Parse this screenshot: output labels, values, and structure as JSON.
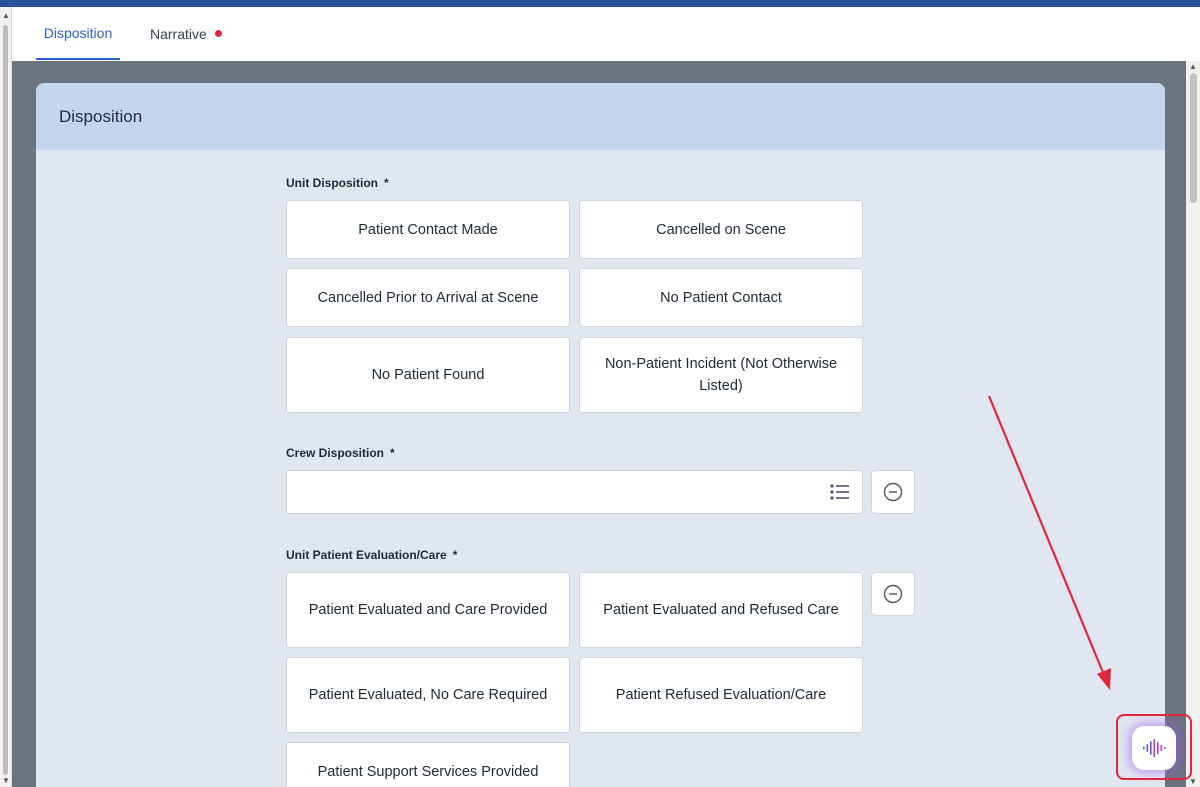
{
  "tabs": [
    {
      "label": "Disposition",
      "active": true
    },
    {
      "label": "Narrative",
      "active": false,
      "has_alert_dot": true
    }
  ],
  "section": {
    "title": "Disposition"
  },
  "unit_disposition": {
    "label": "Unit Disposition",
    "required": "*",
    "options": [
      "Patient Contact Made",
      "Cancelled on Scene",
      "Cancelled Prior to Arrival at Scene",
      "No Patient Contact",
      "No Patient Found",
      "Non-Patient Incident (Not Otherwise Listed)"
    ]
  },
  "crew_disposition": {
    "label": "Crew Disposition",
    "required": "*",
    "value": "",
    "list_icon": "list-icon",
    "clear_icon": "minus-circle-icon"
  },
  "unit_patient_evaluation": {
    "label": "Unit Patient Evaluation/Care",
    "required": "*",
    "options": [
      "Patient Evaluated and Care Provided",
      "Patient Evaluated and Refused Care",
      "Patient Evaluated, No Care Required",
      "Patient Refused Evaluation/Care",
      "Patient Support Services Provided"
    ],
    "clear_icon": "minus-circle-icon"
  },
  "voice_button": {
    "icon": "audio-waveform-icon"
  },
  "colors": {
    "accent": "#2b5fcf",
    "header_bg": "#c4d6ee",
    "card_bg": "#e1e7f0",
    "annotation": "#e0283d",
    "alert_dot": "#e0283d"
  }
}
